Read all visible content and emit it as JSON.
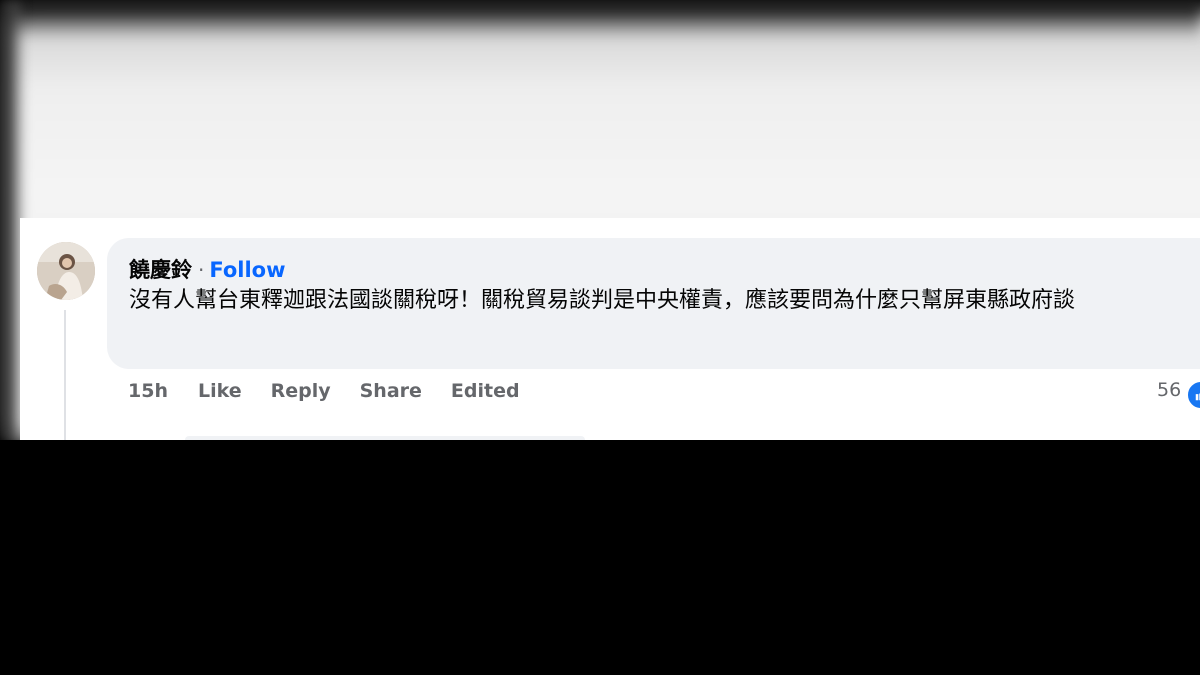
{
  "comment": {
    "author": "饒慶鈴",
    "separator": "·",
    "follow_label": "Follow",
    "text": "沒有人幫台東釋迦跟法國談關稅呀！關稅貿易談判是中央權責，應該要問為什麼只幫屏東縣政府談",
    "avatar_icon": "user-photo-avatar"
  },
  "actions": {
    "time": "15h",
    "like_label": "Like",
    "reply_label": "Reply",
    "share_label": "Share",
    "edited_label": "Edited"
  },
  "reactions": {
    "count": "56",
    "icon": "like-reaction-icon",
    "color": "#1877f2"
  },
  "colors": {
    "follow": "#0866ff",
    "bubble": "#f0f2f5",
    "meta_text": "#65676b"
  }
}
